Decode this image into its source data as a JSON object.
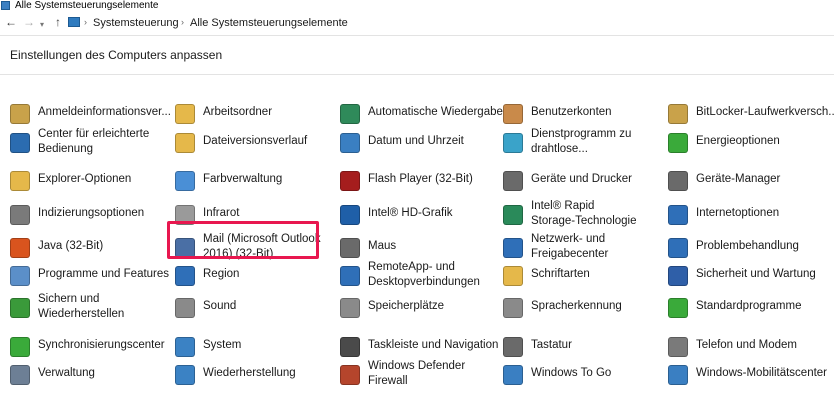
{
  "window": {
    "title": "Alle Systemsteuerungselemente"
  },
  "address": {
    "crumbs": [
      "Systemsteuerung",
      "Alle Systemsteuerungselemente"
    ],
    "separator": "›"
  },
  "nav": {
    "back": "←",
    "forward": "→",
    "dropdown": "▾",
    "up": "↑"
  },
  "heading": "Einstellungen des Computers anpassen",
  "columns": [
    [
      {
        "label": "Anmeldeinformationsver...",
        "icon": "credential-manager-icon",
        "color": "#c9a24a"
      },
      {
        "label": "Center für erleichterte\nBedienung",
        "icon": "ease-of-access-icon",
        "color": "#2b6cb0"
      },
      {
        "label": "Explorer-Optionen",
        "icon": "folder-options-icon",
        "color": "#e5b84a"
      },
      {
        "label": "Indizierungsoptionen",
        "icon": "indexing-options-icon",
        "color": "#7a7a7a"
      },
      {
        "label": "Java (32-Bit)",
        "icon": "java-icon",
        "color": "#d9541e"
      },
      {
        "label": "Programme und Features",
        "icon": "programs-features-icon",
        "color": "#5b8fc9"
      },
      {
        "label": "Sichern und\nWiederherstellen",
        "icon": "backup-restore-icon",
        "color": "#3a9a3a"
      },
      {
        "label": "Synchronisierungscenter",
        "icon": "sync-center-icon",
        "color": "#3aaa3a"
      },
      {
        "label": "Verwaltung",
        "icon": "administrative-tools-icon",
        "color": "#6d7f95"
      }
    ],
    [
      {
        "label": "Arbeitsordner",
        "icon": "work-folders-icon",
        "color": "#e5b84a"
      },
      {
        "label": "Dateiversionsverlauf",
        "icon": "file-history-icon",
        "color": "#e5b84a"
      },
      {
        "label": "Farbverwaltung",
        "icon": "color-management-icon",
        "color": "#4a8fd6"
      },
      {
        "label": "Infrarot",
        "icon": "infrared-icon",
        "color": "#9a9a9a"
      },
      {
        "label": "Mail (Microsoft Outlook\n2016) (32-Bit)",
        "icon": "mail-icon",
        "color": "#4a6fa5"
      },
      {
        "label": "Region",
        "icon": "region-icon",
        "color": "#2f6fb8"
      },
      {
        "label": "Sound",
        "icon": "sound-icon",
        "color": "#8a8a8a"
      },
      {
        "label": "System",
        "icon": "system-icon",
        "color": "#3b82c4"
      },
      {
        "label": "Wiederherstellung",
        "icon": "recovery-icon",
        "color": "#3b82c4"
      }
    ],
    [
      {
        "label": "Automatische Wiedergabe",
        "icon": "autoplay-icon",
        "color": "#2f8a5a"
      },
      {
        "label": "Datum und Uhrzeit",
        "icon": "date-time-icon",
        "color": "#3a7fc2"
      },
      {
        "label": "Flash Player (32-Bit)",
        "icon": "flash-player-icon",
        "color": "#a51d1d"
      },
      {
        "label": "Intel® HD-Grafik",
        "icon": "intel-graphics-icon",
        "color": "#1f5fa8"
      },
      {
        "label": "Maus",
        "icon": "mouse-icon",
        "color": "#6a6a6a"
      },
      {
        "label": "RemoteApp- und\nDesktopverbindungen",
        "icon": "remoteapp-icon",
        "color": "#2f6fb8"
      },
      {
        "label": "Speicherplätze",
        "icon": "storage-spaces-icon",
        "color": "#8a8a8a"
      },
      {
        "label": "Taskleiste und Navigation",
        "icon": "taskbar-icon",
        "color": "#4a4a4a"
      },
      {
        "label": "Windows Defender\nFirewall",
        "icon": "firewall-icon",
        "color": "#b5452c"
      }
    ],
    [
      {
        "label": "Benutzerkonten",
        "icon": "user-accounts-icon",
        "color": "#c98a4a"
      },
      {
        "label": "Dienstprogramm zu\ndrahtlose...",
        "icon": "wireless-utility-icon",
        "color": "#3aa3c9"
      },
      {
        "label": "Geräte und Drucker",
        "icon": "devices-printers-icon",
        "color": "#6a6a6a"
      },
      {
        "label": "Intel® Rapid\nStorage-Technologie",
        "icon": "intel-rst-icon",
        "color": "#2a8a5a"
      },
      {
        "label": "Netzwerk- und\nFreigabecenter",
        "icon": "network-sharing-icon",
        "color": "#2f6fb8"
      },
      {
        "label": "Schriftarten",
        "icon": "fonts-icon",
        "color": "#e5b84a"
      },
      {
        "label": "Spracherkennung",
        "icon": "speech-recognition-icon",
        "color": "#8a8a8a"
      },
      {
        "label": "Tastatur",
        "icon": "keyboard-icon",
        "color": "#6a6a6a"
      },
      {
        "label": "Windows To Go",
        "icon": "windows-to-go-icon",
        "color": "#3a7fc2"
      }
    ],
    [
      {
        "label": "BitLocker-Laufwerkversch...",
        "icon": "bitlocker-icon",
        "color": "#c9a24a"
      },
      {
        "label": "Energieoptionen",
        "icon": "power-options-icon",
        "color": "#3aaa3a"
      },
      {
        "label": "Geräte-Manager",
        "icon": "device-manager-icon",
        "color": "#6a6a6a"
      },
      {
        "label": "Internetoptionen",
        "icon": "internet-options-icon",
        "color": "#2f6fb8"
      },
      {
        "label": "Problembehandlung",
        "icon": "troubleshooting-icon",
        "color": "#2f6fb8"
      },
      {
        "label": "Sicherheit und Wartung",
        "icon": "security-maintenance-icon",
        "color": "#2f5fa8"
      },
      {
        "label": "Standardprogramme",
        "icon": "default-programs-icon",
        "color": "#3aaa3a"
      },
      {
        "label": "Telefon und Modem",
        "icon": "phone-modem-icon",
        "color": "#7a7a7a"
      },
      {
        "label": "Windows-Mobilitätscenter",
        "icon": "mobility-center-icon",
        "color": "#3a7fc2"
      }
    ]
  ]
}
